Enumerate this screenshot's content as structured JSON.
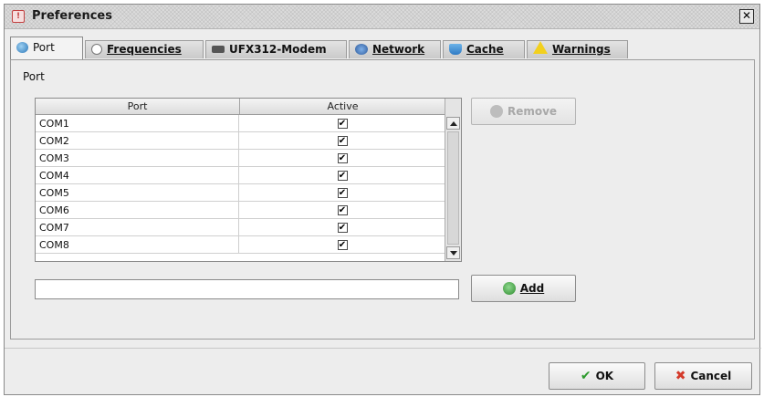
{
  "window": {
    "title": "Preferences",
    "close_glyph": "✕"
  },
  "tabs": [
    {
      "label": "Port",
      "icon": "globe-icon",
      "active": true
    },
    {
      "label": "Frequencies",
      "icon": "clock-icon",
      "active": false
    },
    {
      "label": "UFX312-Modem",
      "icon": "modem-icon",
      "active": false
    },
    {
      "label": "Network",
      "icon": "network-icon",
      "active": false
    },
    {
      "label": "Cache",
      "icon": "cache-icon",
      "active": false
    },
    {
      "label": "Warnings",
      "icon": "warning-icon",
      "active": false
    }
  ],
  "port_panel": {
    "section_label": "Port",
    "table": {
      "columns": [
        "Port",
        "Active"
      ],
      "rows": [
        {
          "port": "COM1",
          "active": true
        },
        {
          "port": "COM2",
          "active": true
        },
        {
          "port": "COM3",
          "active": true
        },
        {
          "port": "COM4",
          "active": true
        },
        {
          "port": "COM5",
          "active": true
        },
        {
          "port": "COM6",
          "active": true
        },
        {
          "port": "COM7",
          "active": true
        },
        {
          "port": "COM8",
          "active": true
        }
      ]
    },
    "remove_button": {
      "label": "Remove",
      "enabled": false
    },
    "port_input": {
      "value": "",
      "placeholder": ""
    },
    "add_button": {
      "label": "Add",
      "enabled": true
    }
  },
  "footer": {
    "ok_label": "OK",
    "cancel_label": "Cancel"
  },
  "colors": {
    "ok_check": "#2c9a2c",
    "cancel_x": "#d43a2a",
    "warning": "#f2d01e",
    "disabled_text": "#a8a8a8"
  }
}
